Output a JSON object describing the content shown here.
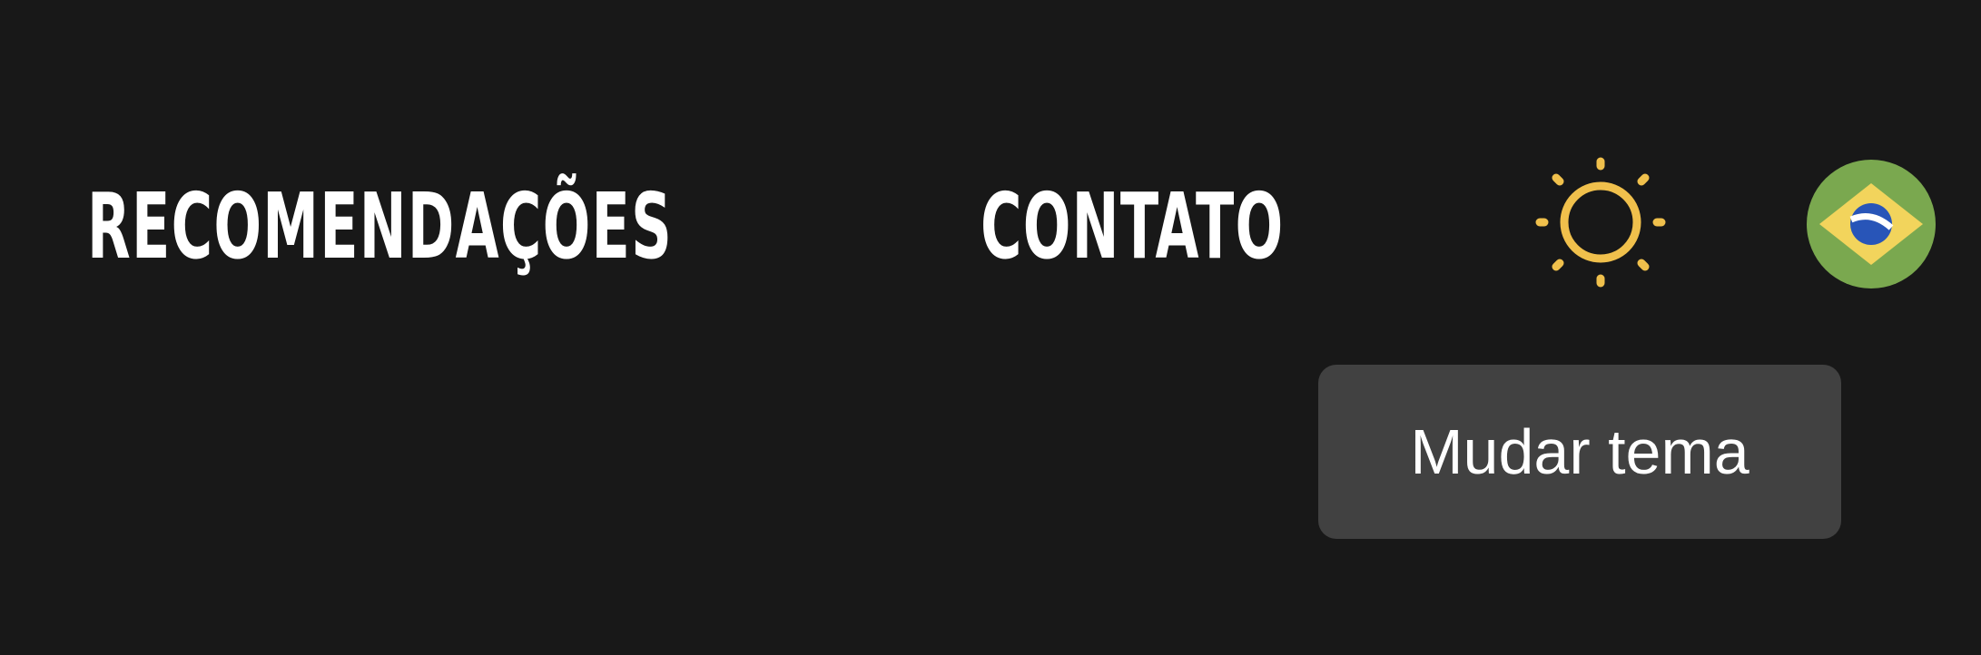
{
  "nav": {
    "items": [
      {
        "label": "RECOMENDAÇÕES"
      },
      {
        "label": "CONTATO"
      }
    ]
  },
  "theme_toggle": {
    "icon": "sun-icon",
    "tooltip": "Mudar tema"
  },
  "language_toggle": {
    "icon": "brazil-flag-icon"
  },
  "colors": {
    "background": "#181818",
    "text": "#ffffff",
    "sun": "#f0c04c",
    "tooltip_bg": "#414141",
    "flag_green": "#7aa84f",
    "flag_yellow": "#f2d45c",
    "flag_blue": "#2855b8"
  }
}
